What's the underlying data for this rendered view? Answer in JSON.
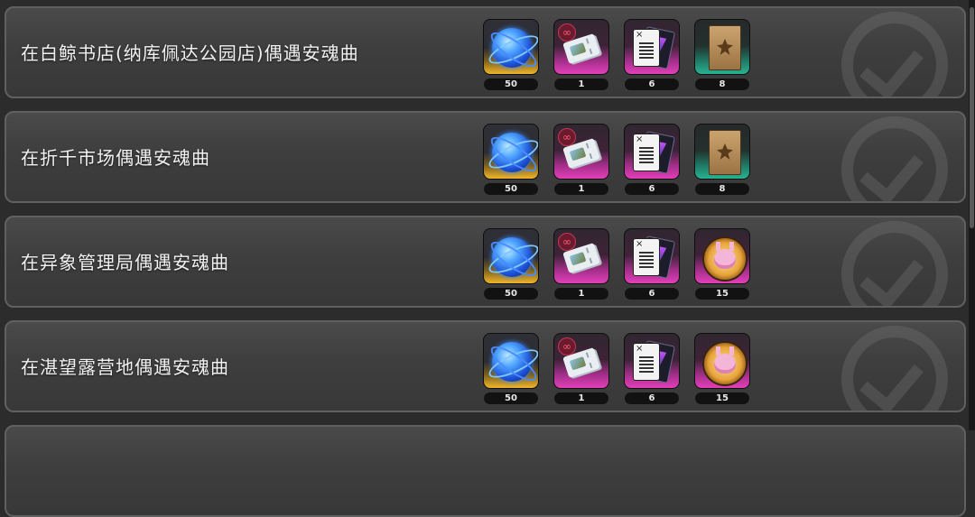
{
  "rows": [
    {
      "title": "在白鲸书店(纳库佩达公园店)偶遇安魂曲",
      "rewards": [
        {
          "icon": "blue-orb-icon",
          "count": "50"
        },
        {
          "icon": "ticket-icon",
          "count": "1"
        },
        {
          "icon": "cards-icon",
          "count": "6"
        },
        {
          "icon": "parchment-icon",
          "count": "8"
        }
      ]
    },
    {
      "title": "在折千市场偶遇安魂曲",
      "rewards": [
        {
          "icon": "blue-orb-icon",
          "count": "50"
        },
        {
          "icon": "ticket-icon",
          "count": "1"
        },
        {
          "icon": "cards-icon",
          "count": "6"
        },
        {
          "icon": "parchment-icon",
          "count": "8"
        }
      ]
    },
    {
      "title": "在异象管理局偶遇安魂曲",
      "rewards": [
        {
          "icon": "blue-orb-icon",
          "count": "50"
        },
        {
          "icon": "ticket-icon",
          "count": "1"
        },
        {
          "icon": "cards-icon",
          "count": "6"
        },
        {
          "icon": "medal-icon",
          "count": "15"
        }
      ]
    },
    {
      "title": "在湛望露营地偶遇安魂曲",
      "rewards": [
        {
          "icon": "blue-orb-icon",
          "count": "50"
        },
        {
          "icon": "ticket-icon",
          "count": "1"
        },
        {
          "icon": "cards-icon",
          "count": "6"
        },
        {
          "icon": "medal-icon",
          "count": "15"
        }
      ]
    },
    {
      "title": "",
      "rewards": []
    }
  ],
  "colors": {
    "gold_rarity": "#f0b52a",
    "magenta_rarity": "#e23fb9",
    "teal_rarity": "#28b390",
    "row_border": "#606060",
    "background": "#2c2c2c"
  }
}
